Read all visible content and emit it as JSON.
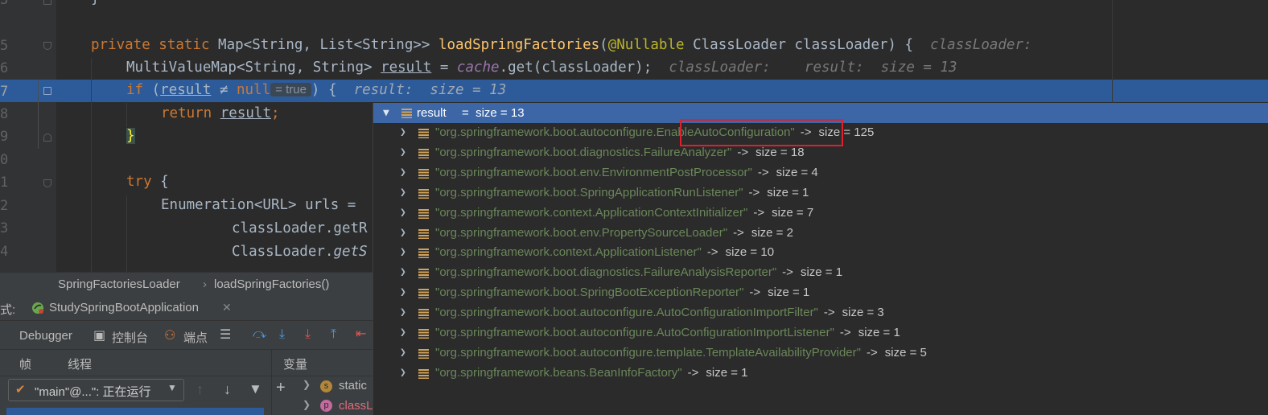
{
  "editor": {
    "line_numbers": [
      "3",
      "",
      "5",
      "6",
      "7",
      "8",
      "9",
      "0",
      "1",
      "2",
      "3",
      "4"
    ],
    "lines": {
      "l3": "}",
      "l5_kw": "private static ",
      "l5_type": "Map<String, List<String>> ",
      "l5_fn": "loadSpringFactories",
      "l5_paren": "(",
      "l5_ann": "@Nullable",
      "l5_rest": " ClassLoader classLoader) {",
      "l5_hint": "classLoader:",
      "l6_type": "MultiValueMap<String, String> ",
      "l6_var": "result",
      "l6_eq": " = ",
      "l6_cache": "cache",
      "l6_rest": ".get(classLoader);",
      "l6_hint1": "classLoader:",
      "l6_hint2": "result:  size = 13",
      "l7_kw": "if",
      "l7_open": " (",
      "l7_var": "result",
      "l7_op": " ≠ ",
      "l7_null": "null",
      "l7_inlay": "= true",
      "l7_close": ") {",
      "l7_hint": "result:  size = 13",
      "l8_kw": "return ",
      "l8_var": "result",
      "l8_semi": ";",
      "l9": "}",
      "l11_kw": "try",
      "l11_brace": " {",
      "l12": "Enumeration<URL> urls =",
      "l13": "classLoader.getR",
      "l14_a": "ClassLoader.",
      "l14_b": "getS"
    }
  },
  "popup": {
    "header_name": "result",
    "header_value": "=  size = 13",
    "entries": [
      {
        "key": "\"org.springframework.boot.autoconfigure.EnableAutoConfiguration\"",
        "size": "size = 125"
      },
      {
        "key": "\"org.springframework.boot.diagnostics.FailureAnalyzer\"",
        "size": "size = 18"
      },
      {
        "key": "\"org.springframework.boot.env.EnvironmentPostProcessor\"",
        "size": "size = 4"
      },
      {
        "key": "\"org.springframework.boot.SpringApplicationRunListener\"",
        "size": "size = 1"
      },
      {
        "key": "\"org.springframework.context.ApplicationContextInitializer\"",
        "size": "size = 7"
      },
      {
        "key": "\"org.springframework.boot.env.PropertySourceLoader\"",
        "size": "size = 2"
      },
      {
        "key": "\"org.springframework.context.ApplicationListener\"",
        "size": "size = 10"
      },
      {
        "key": "\"org.springframework.boot.diagnostics.FailureAnalysisReporter\"",
        "size": "size = 1"
      },
      {
        "key": "\"org.springframework.boot.SpringBootExceptionReporter\"",
        "size": "size = 1"
      },
      {
        "key": "\"org.springframework.boot.autoconfigure.AutoConfigurationImportFilter\"",
        "size": "size = 3"
      },
      {
        "key": "\"org.springframework.boot.autoconfigure.AutoConfigurationImportListener\"",
        "size": "size = 1"
      },
      {
        "key": "\"org.springframework.boot.autoconfigure.template.TemplateAvailabilityProvider\"",
        "size": "size = 5"
      },
      {
        "key": "\"org.springframework.beans.BeanInfoFactory\"",
        "size": "size = 1"
      }
    ],
    "arrow_glyph": "->",
    "highlight_color": "#e0202a"
  },
  "breadcrumb": {
    "class_name": "SpringFactoriesLoader",
    "separator": "›",
    "method_name": "loadSpringFactories()"
  },
  "debug": {
    "label_prefix": "式:",
    "run_config": "StudySpringBootApplication",
    "tab_debugger": "Debugger",
    "tab_console": "控制台",
    "tab_breakpoints": "端点",
    "frames_header": "帧",
    "threads_header": "线程",
    "variables_header": "变量",
    "thread_select": "\"main\"@...\": 正在运行",
    "var1_badge": "s",
    "var1": "static",
    "var2_badge": "p",
    "var2": "classL"
  }
}
